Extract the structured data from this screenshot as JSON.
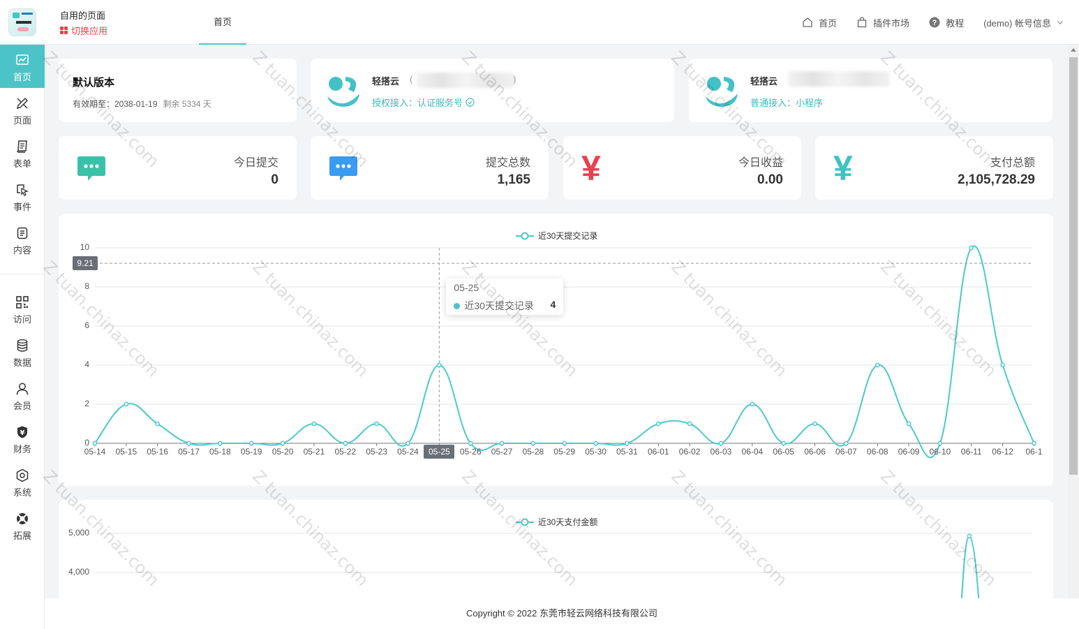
{
  "header": {
    "app_name": "自用的页面",
    "switch_app": "切换应用",
    "active_tab": "首页",
    "nav": [
      {
        "label": "首页",
        "icon": "home-icon"
      },
      {
        "label": "插件市场",
        "icon": "shopping-bag-icon"
      },
      {
        "label": "教程",
        "icon": "help-circle-icon"
      },
      {
        "label": "(demo) 帐号信息",
        "icon": "chevron-down-icon"
      }
    ]
  },
  "sidebar": {
    "items": [
      {
        "label": "首页",
        "icon": "dashboard-chart-icon",
        "active": true
      },
      {
        "label": "页面",
        "icon": "design-tools-icon"
      },
      {
        "label": "表单",
        "icon": "form-sheet-icon"
      },
      {
        "label": "事件",
        "icon": "event-cursor-icon"
      },
      {
        "label": "内容",
        "icon": "content-doc-icon"
      },
      {
        "label": "访问",
        "icon": "qr-code-icon"
      },
      {
        "label": "数据",
        "icon": "database-icon"
      },
      {
        "label": "会员",
        "icon": "user-icon"
      },
      {
        "label": "财务",
        "icon": "yen-shield-icon"
      },
      {
        "label": "系统",
        "icon": "settings-hex-icon"
      },
      {
        "label": "拓展",
        "icon": "extension-ring-icon"
      }
    ]
  },
  "version_card": {
    "title": "默认版本",
    "expiry_label": "有效期至：2038-01-19",
    "remaining": "剩余 5334 天"
  },
  "accounts": [
    {
      "name": "轻搭云",
      "paren_open": "(",
      "paren_close": ")",
      "link": "授权接入：认证服务号",
      "icon": "check-circle-icon"
    },
    {
      "name": "轻搭云",
      "link": "普通接入：小程序"
    }
  ],
  "stats": [
    {
      "label": "今日提交",
      "value": "0",
      "icon": "chat-bubble-icon",
      "color": "#39c2a7"
    },
    {
      "label": "提交总数",
      "value": "1,165",
      "icon": "chat-bubble-icon",
      "color": "#3a9bf0"
    },
    {
      "label": "今日收益",
      "value": "0.00",
      "icon": "yen-icon",
      "glyph": "¥",
      "color": "#e8414f"
    },
    {
      "label": "支付总额",
      "value": "2,105,728.29",
      "icon": "yen-icon",
      "glyph": "¥",
      "color": "#3ec3c0"
    }
  ],
  "chart_data": [
    {
      "type": "line",
      "title": "",
      "legend": "近30天提交记录",
      "legend_position": "top-center",
      "categories": [
        "05-14",
        "05-15",
        "05-16",
        "05-17",
        "05-18",
        "05-19",
        "05-20",
        "05-21",
        "05-22",
        "05-23",
        "05-24",
        "05-25",
        "05-26",
        "05-27",
        "05-28",
        "05-29",
        "05-30",
        "05-31",
        "06-01",
        "06-02",
        "06-03",
        "06-04",
        "06-05",
        "06-06",
        "06-07",
        "06-08",
        "06-09",
        "06-10",
        "06-11",
        "06-12",
        "06-1"
      ],
      "series": [
        {
          "name": "近30天提交记录",
          "values": [
            0,
            2,
            1,
            0,
            0,
            0,
            0,
            1,
            0,
            1,
            0,
            4,
            0,
            0,
            0,
            0,
            0,
            0,
            1,
            1,
            0,
            2,
            0,
            1,
            0,
            4,
            1,
            0,
            10,
            4,
            0
          ]
        }
      ],
      "y_ticks": [
        "0",
        "2",
        "4",
        "6",
        "8",
        "10"
      ],
      "ylim": [
        0,
        10
      ],
      "grid": true,
      "color": "#4cc9cc",
      "axis_pointer": {
        "x": "05-25",
        "y": "9.21"
      },
      "tooltip": {
        "title": "05-25",
        "series": "近30天提交记录",
        "value": "4"
      }
    },
    {
      "type": "line",
      "title": "",
      "legend": "近30天支付金额",
      "legend_position": "top-center",
      "y_ticks": [
        "4,000",
        "5,000"
      ],
      "visible_range": [
        3400,
        5000
      ],
      "series": [
        {
          "name": "近30天支付金额",
          "values": [
            {
              "x": "06-11",
              "y": 4930
            }
          ]
        }
      ],
      "grid": true,
      "color": "#4cc9cc"
    }
  ],
  "footer": {
    "copyright": "Copyright © 2022 东莞市轻云网络科技有限公司"
  },
  "watermark": {
    "text": "tuan.chinaz.com"
  }
}
